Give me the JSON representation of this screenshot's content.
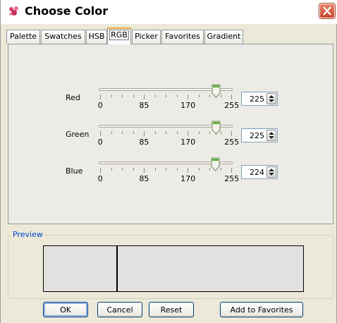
{
  "window": {
    "title": "Choose Color"
  },
  "tabs": [
    {
      "label": "Palette"
    },
    {
      "label": "Swatches"
    },
    {
      "label": "HSB"
    },
    {
      "label": "RGB"
    },
    {
      "label": "Picker"
    },
    {
      "label": "Favorites"
    },
    {
      "label": "Gradient"
    }
  ],
  "active_tab": "RGB",
  "rgb": {
    "tick_labels": [
      "0",
      "85",
      "170",
      "255"
    ],
    "channels": [
      {
        "label": "Red",
        "value": "225"
      },
      {
        "label": "Green",
        "value": "225"
      },
      {
        "label": "Blue",
        "value": "224"
      }
    ]
  },
  "preview": {
    "label": "Preview"
  },
  "buttons": {
    "ok": "OK",
    "cancel": "Cancel",
    "reset": "Reset",
    "add_favorites": "Add to Favorites"
  },
  "colors": {
    "current_color": "#e1e1e0",
    "accent": "#e6a631"
  }
}
